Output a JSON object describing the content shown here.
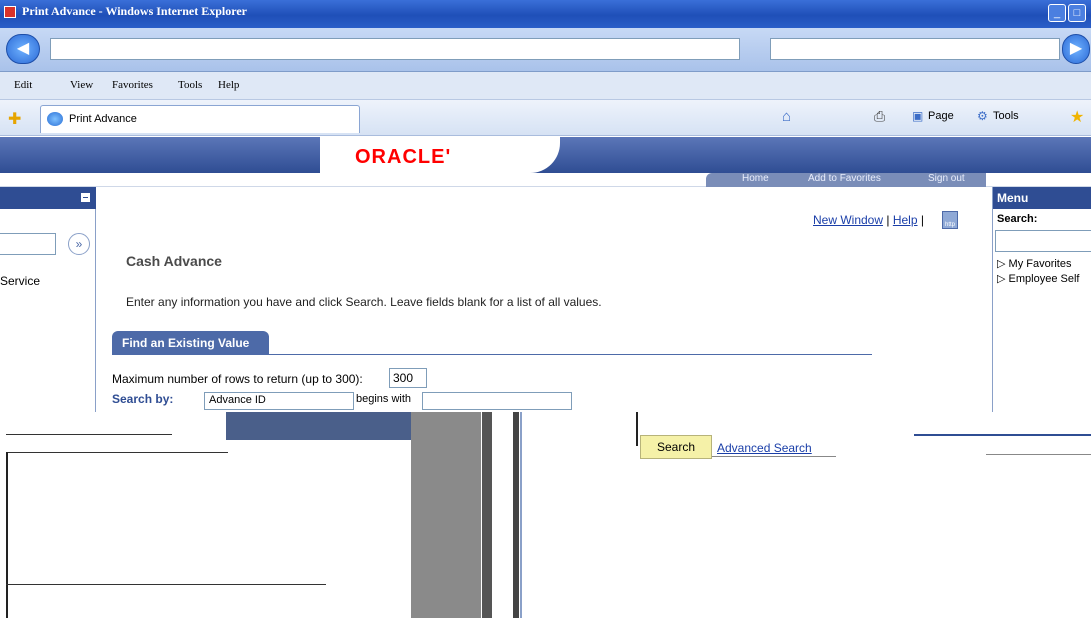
{
  "browser": {
    "window_title": "Print Advance - Windows Internet Explorer",
    "menu": [
      "Edit",
      "View",
      "Favorites",
      "Tools",
      "Help"
    ],
    "tab_label": "Print Advance",
    "commands": {
      "page": "Page",
      "tools": "Tools"
    }
  },
  "header": {
    "logo": "ORACLE'",
    "links": [
      "Home",
      "Add to Favorites",
      "Sign out"
    ]
  },
  "left_pane": {
    "go_symbol": "»",
    "item_text": "Service"
  },
  "menu_pane": {
    "title": "Menu",
    "search_label": "Search:",
    "items": [
      "My Favorites",
      "Employee Self"
    ]
  },
  "main": {
    "new_window": "New Window",
    "help": "Help",
    "http_icon_text": "http",
    "title": "Cash Advance",
    "instructions": "Enter any information you have and click Search. Leave fields blank for a list of all values.",
    "find_tab": "Find an Existing Value",
    "max_rows_label": "Maximum number of rows to return (up to 300):",
    "max_rows_value": "300",
    "search_by_label": "Search by:",
    "search_by_value": "Advance ID",
    "begins_with": "begins with",
    "search_button": "Search",
    "advanced_search": "Advanced Search"
  },
  "colors": {
    "ps_blue": "#2f4d93",
    "tab_blue": "#4d6aa8",
    "oracle_red": "#ff0000",
    "search_button": "#f5f1a8"
  }
}
